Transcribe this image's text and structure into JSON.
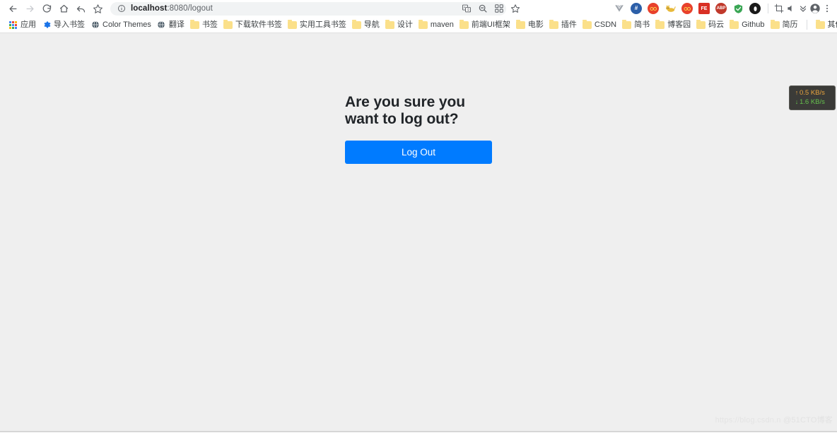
{
  "browser": {
    "nav": {
      "back": "Back",
      "forward": "Forward",
      "reload": "Reload",
      "home": "Home",
      "undo": "Undo",
      "bookmark_star": "Bookmark this page"
    },
    "omnibox": {
      "info_icon": "info-circle-icon",
      "host": "localhost",
      "path": ":8080/logout",
      "full_url": "localhost:8080/logout"
    },
    "omni_actions": [
      {
        "name": "translate-icon",
        "glyph": "translate"
      },
      {
        "name": "zoom-out-icon",
        "glyph": "zoom-out"
      },
      {
        "name": "qr-code-icon",
        "glyph": "qr"
      },
      {
        "name": "bookmark-star-icon",
        "glyph": "star"
      }
    ],
    "extensions": [
      {
        "name": "vue-devtools-icon",
        "label": "V",
        "color": "#9ea4ab"
      },
      {
        "name": "hash-extension-icon",
        "label": "#",
        "color": "#2c5fa8"
      },
      {
        "name": "infinity-extension-icon",
        "label": "",
        "color": "#e8412c"
      },
      {
        "name": "cat-extension-icon",
        "label": "",
        "color": "#e8b93a"
      },
      {
        "name": "infinity-red-extension-icon",
        "label": "",
        "color": "#e8412c"
      },
      {
        "name": "fe-extension-icon",
        "label": "FE",
        "color": "#d93025"
      },
      {
        "name": "adblock-plus-icon",
        "label": "ABP",
        "color": "#c0392b"
      },
      {
        "name": "adguard-shield-icon",
        "label": "",
        "color": "#3aa655"
      },
      {
        "name": "opera-extension-icon",
        "label": "",
        "color": "#1a1a1a"
      }
    ],
    "right_actions": [
      {
        "name": "screenshot-crop-icon"
      },
      {
        "name": "mute-speaker-icon"
      },
      {
        "name": "chevrons-down-icon"
      },
      {
        "name": "profile-avatar-icon"
      },
      {
        "name": "more-menu-icon"
      }
    ]
  },
  "bookmarks": {
    "apps_label": "应用",
    "items": [
      {
        "label": "导入书签",
        "icon": "gear-icon"
      },
      {
        "label": "Color Themes",
        "icon": "globe-icon"
      },
      {
        "label": "翻译",
        "icon": "globe-icon"
      },
      {
        "label": "书签",
        "icon": "folder-icon"
      },
      {
        "label": "下载软件书签",
        "icon": "folder-icon"
      },
      {
        "label": "实用工具书签",
        "icon": "folder-icon"
      },
      {
        "label": "导航",
        "icon": "folder-icon"
      },
      {
        "label": "设计",
        "icon": "folder-icon"
      },
      {
        "label": "maven",
        "icon": "folder-icon"
      },
      {
        "label": "前端UI框架",
        "icon": "folder-icon"
      },
      {
        "label": "电影",
        "icon": "folder-icon"
      },
      {
        "label": "插件",
        "icon": "folder-icon"
      },
      {
        "label": "CSDN",
        "icon": "folder-icon"
      },
      {
        "label": "简书",
        "icon": "folder-icon"
      },
      {
        "label": "博客园",
        "icon": "folder-icon"
      },
      {
        "label": "码云",
        "icon": "folder-icon"
      },
      {
        "label": "Github",
        "icon": "folder-icon"
      },
      {
        "label": "简历",
        "icon": "folder-icon"
      }
    ],
    "other_bookmarks": {
      "label": "其他书签",
      "icon": "folder-icon"
    }
  },
  "page": {
    "heading": "Are you sure you\nwant to log out?",
    "logout_button": "Log Out",
    "background_color": "#efefef",
    "button_color": "#007bff"
  },
  "netspeed": {
    "upload": "0.5 KB/s",
    "download": "1.6 KB/s",
    "up_arrow": "↑",
    "down_arrow": "↓",
    "up_color": "#e8a33d",
    "down_color": "#66c14d"
  },
  "watermark": {
    "url": "https://blog.csdn.n",
    "badge": "@51CTO博客"
  }
}
